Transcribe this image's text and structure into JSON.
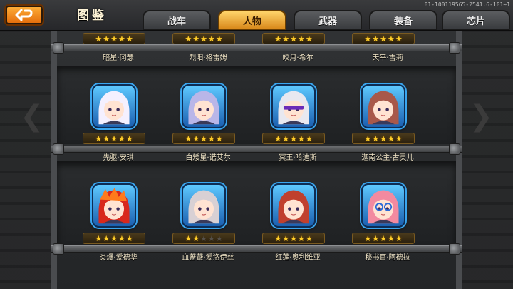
{
  "header": {
    "title": "图鉴",
    "version": "01-100119565-2541.6-101~1",
    "back_label": "back"
  },
  "tabs": [
    {
      "label": "战车",
      "active": false
    },
    {
      "label": "人物",
      "active": true
    },
    {
      "label": "武器",
      "active": false
    },
    {
      "label": "装备",
      "active": false
    },
    {
      "label": "芯片",
      "active": false
    }
  ],
  "top_row": [
    {
      "name": "暗星·冈瑟",
      "stars": 5
    },
    {
      "name": "烈阳·格雷姆",
      "stars": 5
    },
    {
      "name": "皎月·希尔",
      "stars": 5
    },
    {
      "name": "天平·雪莉",
      "stars": 5
    }
  ],
  "rows": [
    [
      {
        "name": "先驱·安琪",
        "stars": 5,
        "portrait": "white-haired-girl"
      },
      {
        "name": "白矮星·诺艾尔",
        "stars": 5,
        "portrait": "lilac-haired-girl"
      },
      {
        "name": "冥王·哈迪斯",
        "stars": 5,
        "portrait": "visored-man"
      },
      {
        "name": "迦南公主·古灵儿",
        "stars": 5,
        "portrait": "winking-girl"
      }
    ],
    [
      {
        "name": "炎爆·爱德华",
        "stars": 5,
        "portrait": "flame-haired-boy"
      },
      {
        "name": "血蔷薇·爱洛伊丝",
        "stars": 2,
        "portrait": "silver-haired-girl"
      },
      {
        "name": "红莲·奥利维亚",
        "stars": 5,
        "portrait": "red-haired-girl"
      },
      {
        "name": "秘书官·阿德拉",
        "stars": 5,
        "portrait": "glasses-girl"
      }
    ]
  ],
  "colors": {
    "accent": "#ffb13a",
    "star_on": "#ffcf2a",
    "portrait_border": "#3aa6f0"
  }
}
